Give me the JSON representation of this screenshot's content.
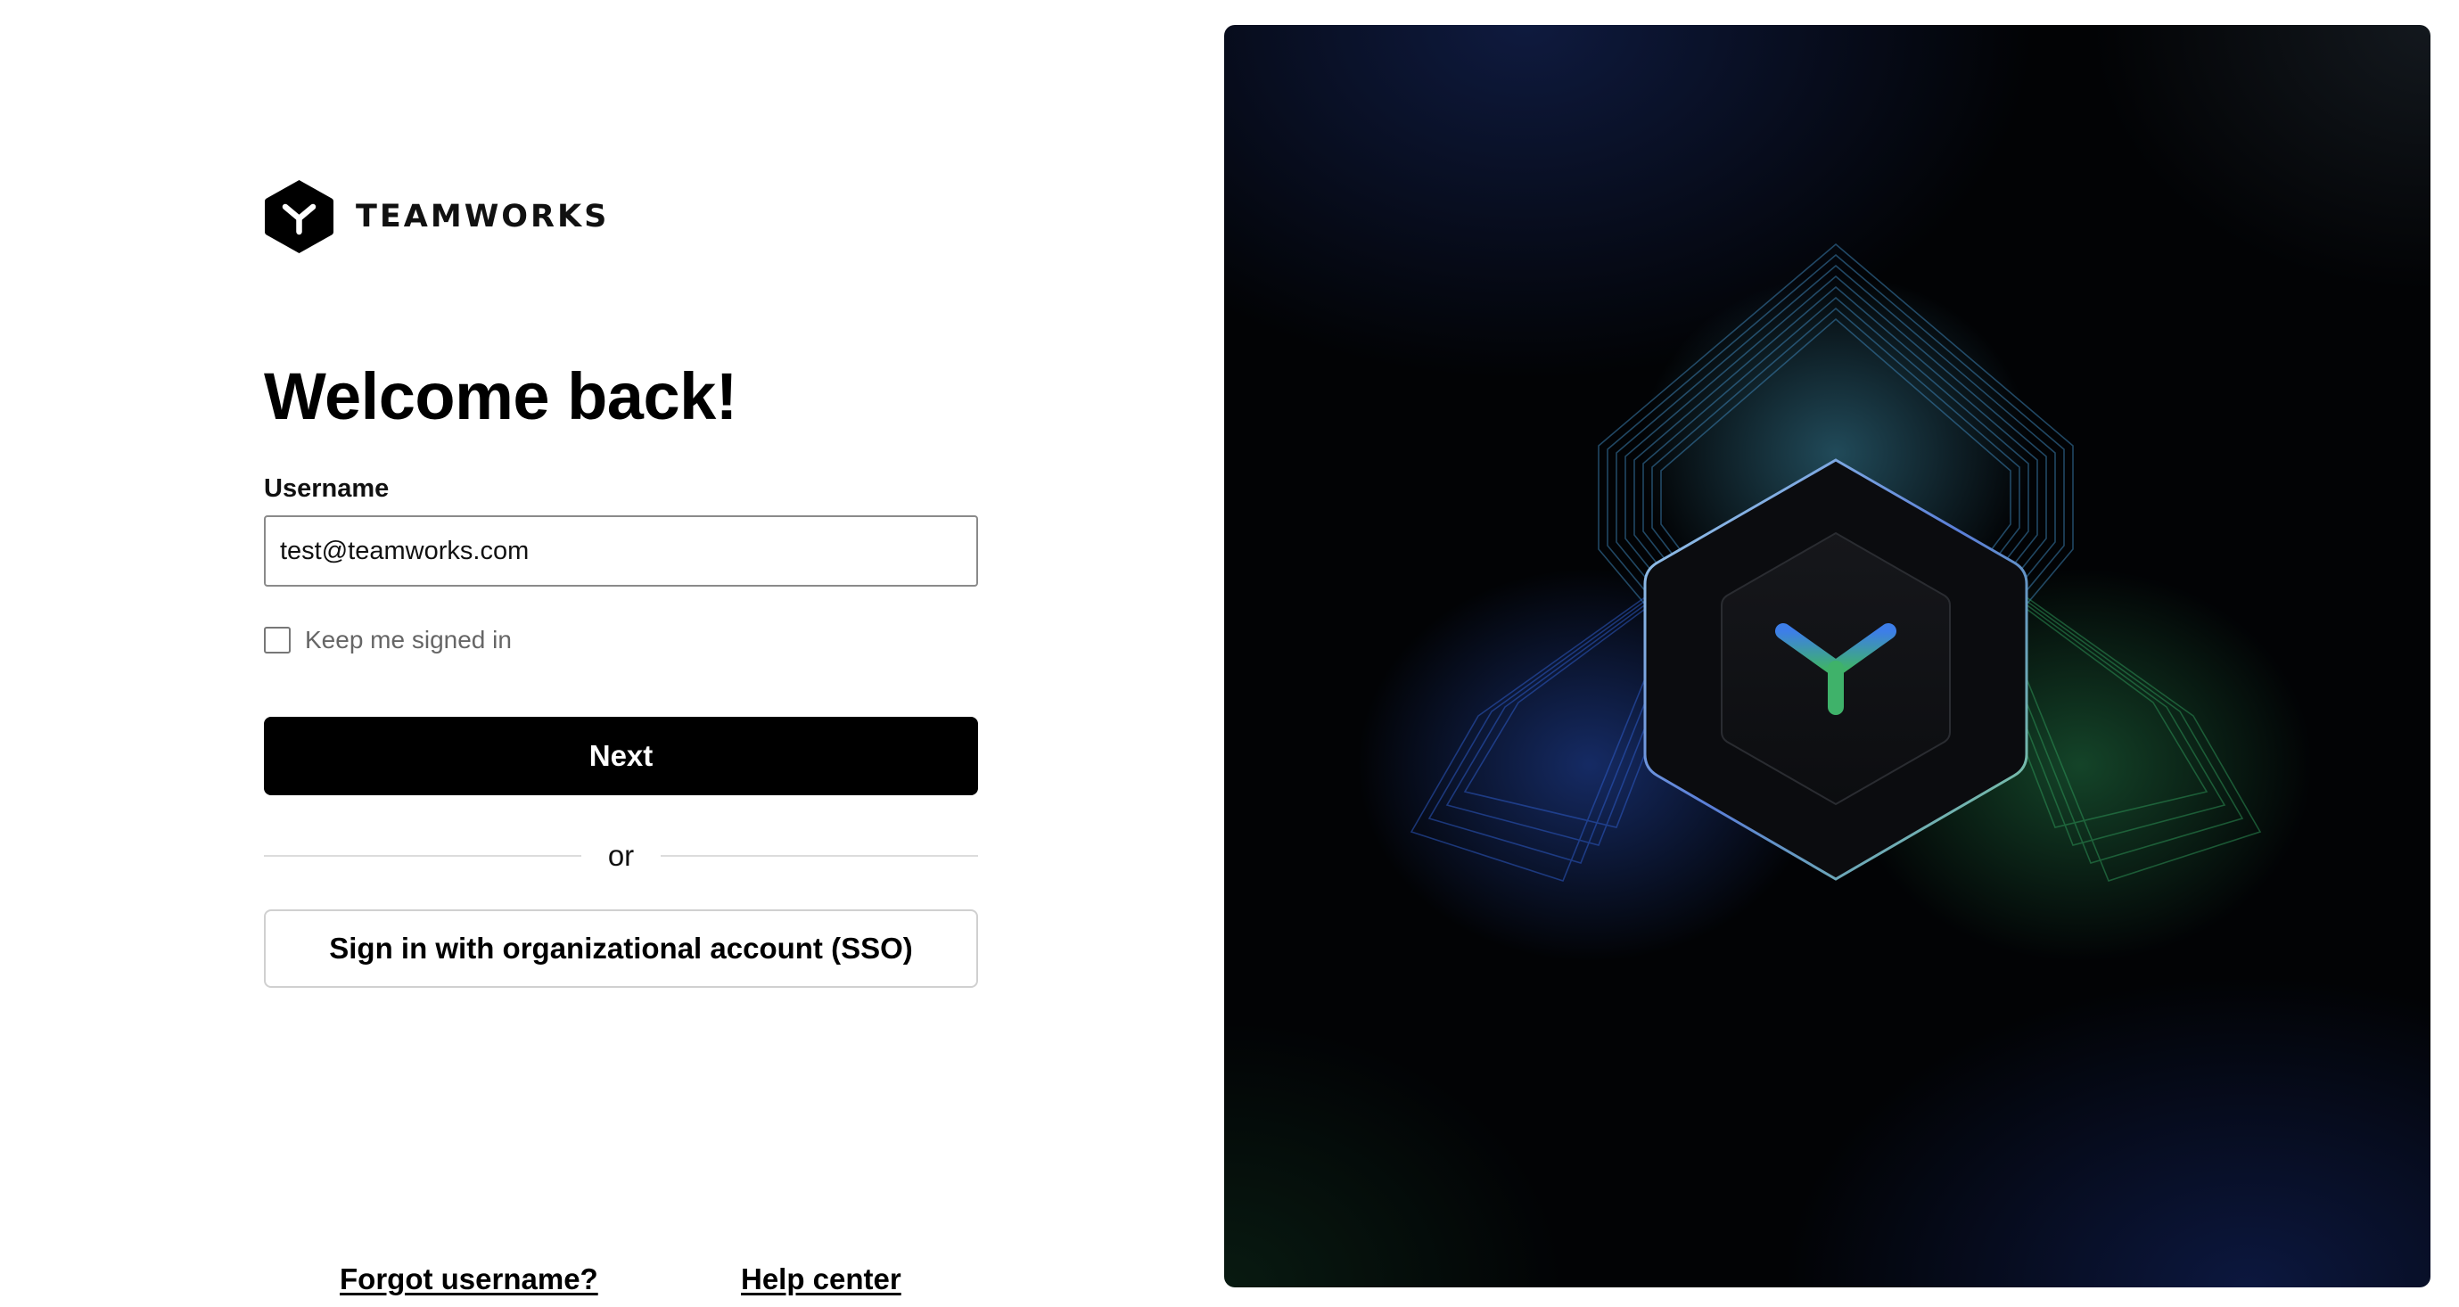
{
  "brand": {
    "name": "TEAMWORKS",
    "logo_icon": "teamworks-hexagon-logo-icon"
  },
  "login": {
    "heading": "Welcome back!",
    "username_label": "Username",
    "username_value": "test@teamworks.com",
    "keep_signed_in_label": "Keep me signed in",
    "keep_signed_in_checked": false,
    "next_label": "Next",
    "divider_text": "or",
    "sso_label": "Sign in with organizational account (SSO)"
  },
  "links": {
    "forgot_username": "Forgot username?",
    "help_center": "Help center"
  },
  "hero": {
    "art_icon": "teamworks-glowing-hexagon-icon"
  },
  "colors": {
    "primary_button": "#000000",
    "hero_background": "#020305",
    "accent_blue": "#3f7fe0",
    "accent_green": "#3fae6a"
  }
}
